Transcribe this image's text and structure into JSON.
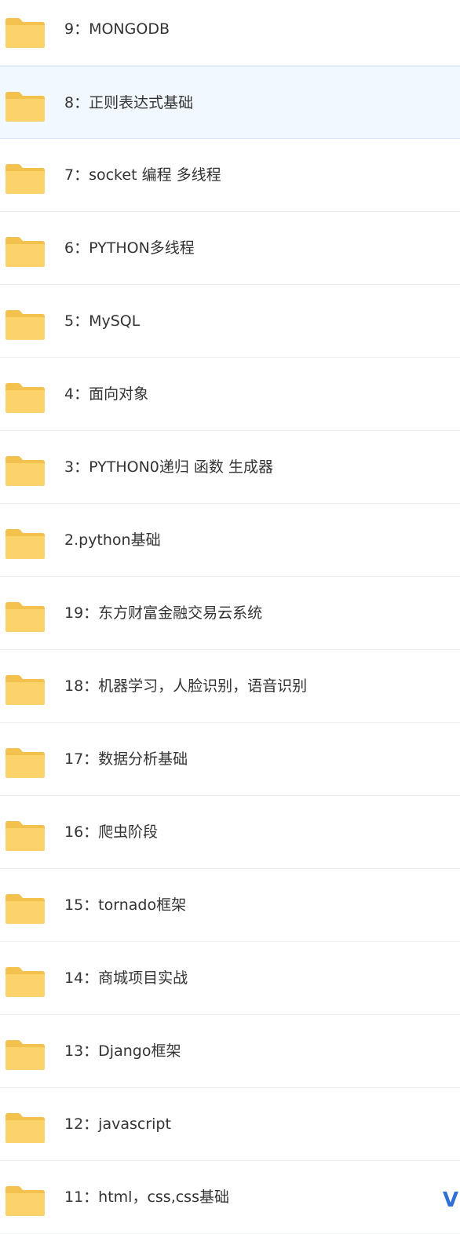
{
  "colors": {
    "folder": "#fbd36a",
    "folder_tab": "#f2c14e",
    "selected_bg": "#f2f8ff",
    "text": "#333333",
    "accent": "#2f6fd6"
  },
  "folders": [
    {
      "name": "9：MONGODB",
      "icon": "folder-icon",
      "selected": false
    },
    {
      "name": "8：正则表达式基础",
      "icon": "folder-icon",
      "selected": true
    },
    {
      "name": "7：socket 编程 多线程",
      "icon": "folder-icon",
      "selected": false
    },
    {
      "name": "6：PYTHON多线程",
      "icon": "folder-icon",
      "selected": false
    },
    {
      "name": "5：MySQL",
      "icon": "folder-icon",
      "selected": false
    },
    {
      "name": "4：面向对象",
      "icon": "folder-icon",
      "selected": false
    },
    {
      "name": "3：PYTHON0递归 函数 生成器",
      "icon": "folder-icon",
      "selected": false
    },
    {
      "name": "2.python基础",
      "icon": "folder-icon",
      "selected": false
    },
    {
      "name": "19：东方财富金融交易云系统",
      "icon": "folder-icon",
      "selected": false
    },
    {
      "name": "18：机器学习，人脸识别，语音识别",
      "icon": "folder-icon",
      "selected": false
    },
    {
      "name": "17：数据分析基础",
      "icon": "folder-icon",
      "selected": false
    },
    {
      "name": "16：爬虫阶段",
      "icon": "folder-icon",
      "selected": false
    },
    {
      "name": "15：tornado框架",
      "icon": "folder-icon",
      "selected": false
    },
    {
      "name": "14：商城项目实战",
      "icon": "folder-icon",
      "selected": false
    },
    {
      "name": "13：Django框架",
      "icon": "folder-icon",
      "selected": false
    },
    {
      "name": "12：javascript",
      "icon": "folder-icon",
      "selected": false
    },
    {
      "name": "11：html，css,css基础",
      "icon": "folder-icon",
      "selected": false
    }
  ],
  "corner_mark": "V"
}
